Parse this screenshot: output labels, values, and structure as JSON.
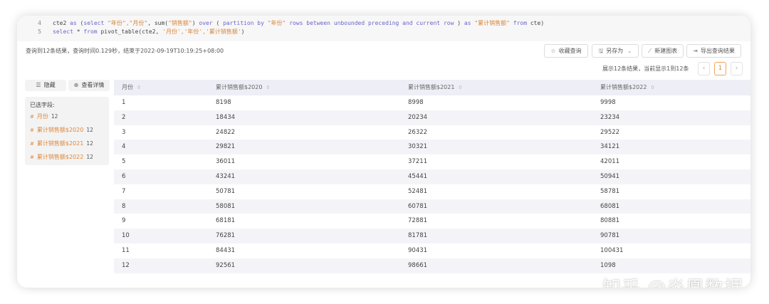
{
  "editor": {
    "lines": [
      {
        "number": "4",
        "segments": [
          {
            "t": "cte2 ",
            "c": "plain"
          },
          {
            "t": "as",
            "c": "kw"
          },
          {
            "t": " (",
            "c": "plain"
          },
          {
            "t": "select",
            "c": "kw"
          },
          {
            "t": " ",
            "c": "plain"
          },
          {
            "t": "\"年份\",\"月份\"",
            "c": "str"
          },
          {
            "t": ", sum(",
            "c": "plain"
          },
          {
            "t": "\"销售额\"",
            "c": "str"
          },
          {
            "t": ") ",
            "c": "plain"
          },
          {
            "t": "over",
            "c": "kw"
          },
          {
            "t": " ( ",
            "c": "plain"
          },
          {
            "t": "partition by",
            "c": "kw"
          },
          {
            "t": " ",
            "c": "plain"
          },
          {
            "t": "\"年份\"",
            "c": "str"
          },
          {
            "t": " ",
            "c": "plain"
          },
          {
            "t": "rows between unbounded preceding and current row",
            "c": "kw"
          },
          {
            "t": " ) ",
            "c": "plain"
          },
          {
            "t": "as",
            "c": "kw"
          },
          {
            "t": " ",
            "c": "plain"
          },
          {
            "t": "\"累计销售额\"",
            "c": "str"
          },
          {
            "t": " ",
            "c": "plain"
          },
          {
            "t": "from",
            "c": "kw"
          },
          {
            "t": " cte)",
            "c": "plain"
          }
        ]
      },
      {
        "number": "5",
        "segments": [
          {
            "t": "select",
            "c": "kw"
          },
          {
            "t": " * ",
            "c": "plain"
          },
          {
            "t": "from",
            "c": "kw"
          },
          {
            "t": " pivot_table(cte2, ",
            "c": "plain"
          },
          {
            "t": "'月份','年份','累计销售额'",
            "c": "str"
          },
          {
            "t": ")",
            "c": "plain"
          }
        ]
      }
    ]
  },
  "status_text": "查询到12条结果，查询时间0.129秒，结束于2022-09-19T10:19:25+08:00",
  "toolbar": {
    "favorite": {
      "icon": "star-icon",
      "glyph": "☆",
      "label": "收藏查询"
    },
    "save_as": {
      "icon": "save-icon",
      "glyph": "🖫",
      "label": "另存为",
      "caret": "⌄"
    },
    "new_chart": {
      "icon": "chart-icon",
      "glyph": "⟋",
      "label": "新建图表"
    },
    "export": {
      "icon": "export-icon",
      "glyph": "⇥",
      "label": "导出查询结果"
    }
  },
  "pager": {
    "summary": "展示12条结果，当前显示1到12条",
    "prev": "‹",
    "current": "1",
    "next": "›"
  },
  "side": {
    "hide_label": "隐藏",
    "hide_glyph": "☰",
    "details_label": "查看详情",
    "details_glyph": "⊕",
    "selected_title": "已选字段:",
    "fields": [
      {
        "name": "月份",
        "count": "12"
      },
      {
        "name": "累计销售额$2020",
        "count": "12"
      },
      {
        "name": "累计销售额$2021",
        "count": "12"
      },
      {
        "name": "累计销售额$2022",
        "count": "12"
      }
    ],
    "field_glyph": "#"
  },
  "table": {
    "columns": [
      "月份",
      "累计销售额$2020",
      "累计销售额$2021",
      "累计销售额$2022"
    ],
    "sort_glyph": "⇳",
    "rows": [
      [
        "1",
        "8198",
        "8998",
        "9998"
      ],
      [
        "2",
        "18434",
        "20234",
        "23234"
      ],
      [
        "3",
        "24822",
        "26322",
        "29522"
      ],
      [
        "4",
        "29821",
        "30321",
        "34121"
      ],
      [
        "5",
        "36011",
        "37211",
        "42011"
      ],
      [
        "6",
        "43241",
        "45441",
        "50941"
      ],
      [
        "7",
        "50781",
        "52481",
        "58781"
      ],
      [
        "8",
        "58081",
        "60781",
        "68081"
      ],
      [
        "9",
        "68181",
        "72881",
        "80881"
      ],
      [
        "10",
        "76281",
        "81781",
        "90781"
      ],
      [
        "11",
        "84431",
        "90431",
        "100431"
      ],
      [
        "12",
        "92561",
        "98661",
        "1098"
      ]
    ]
  },
  "watermark": "知乎 @炎凰数据",
  "colors": {
    "accent": "#e38a35",
    "keyword": "#6c64c8",
    "string": "#d8863a",
    "header_bg": "#eeeef6"
  }
}
